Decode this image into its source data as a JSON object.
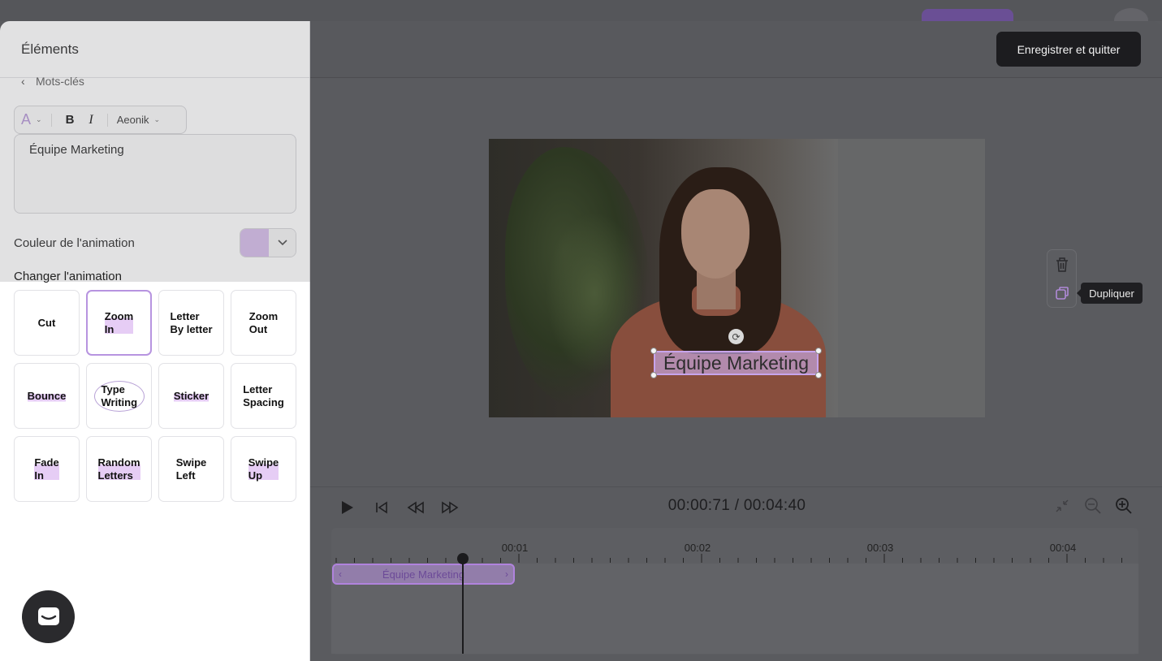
{
  "panel": {
    "title": "Éléments",
    "back_label": "Mots-clés",
    "toolbar": {
      "color_glyph": "A",
      "bold": "B",
      "italic": "I",
      "font_name": "Aeonik"
    },
    "text_value": "Équipe Marketing",
    "animation_color_label": "Couleur de l'animation",
    "animation_color": "#d8c0ec",
    "change_animation_label": "Changer l'animation",
    "animations": [
      {
        "label": "Cut",
        "style": "plain",
        "selected": false
      },
      {
        "label": "Zoom\nIn",
        "style": "highlight",
        "selected": true
      },
      {
        "label": "Letter\nBy letter",
        "style": "plain",
        "selected": false
      },
      {
        "label": "Zoom\nOut",
        "style": "plain",
        "selected": false
      },
      {
        "label": "Bounce",
        "style": "highlight",
        "selected": false
      },
      {
        "label": "Type\nWriting",
        "style": "circle",
        "selected": false
      },
      {
        "label": "Sticker",
        "style": "highlight",
        "selected": false
      },
      {
        "label": "Letter\nSpacing",
        "style": "plain",
        "selected": false
      },
      {
        "label": "Fade\nIn",
        "style": "highlight",
        "selected": false
      },
      {
        "label": "Random\nLetters",
        "style": "highlight",
        "selected": false
      },
      {
        "label": "Swipe\nLeft",
        "style": "plain",
        "selected": false
      },
      {
        "label": "Swipe\nUp",
        "style": "highlight",
        "selected": false
      }
    ]
  },
  "header": {
    "save_button": "Enregistrer et quitter"
  },
  "canvas": {
    "overlay_text": "Équipe Marketing",
    "tooltip": "Dupliquer"
  },
  "player": {
    "current_time": "00:00:71",
    "total_time": "00:04:40",
    "time_display": "00:00:71 / 00:04:40"
  },
  "timeline": {
    "ticks": [
      "00:01",
      "00:02",
      "00:03",
      "00:04"
    ],
    "clip_label": "Équipe Marketing"
  },
  "colors": {
    "accent": "#b794e0",
    "save_button_bg": "#1c1c1f",
    "overlay": "#595a5e"
  }
}
